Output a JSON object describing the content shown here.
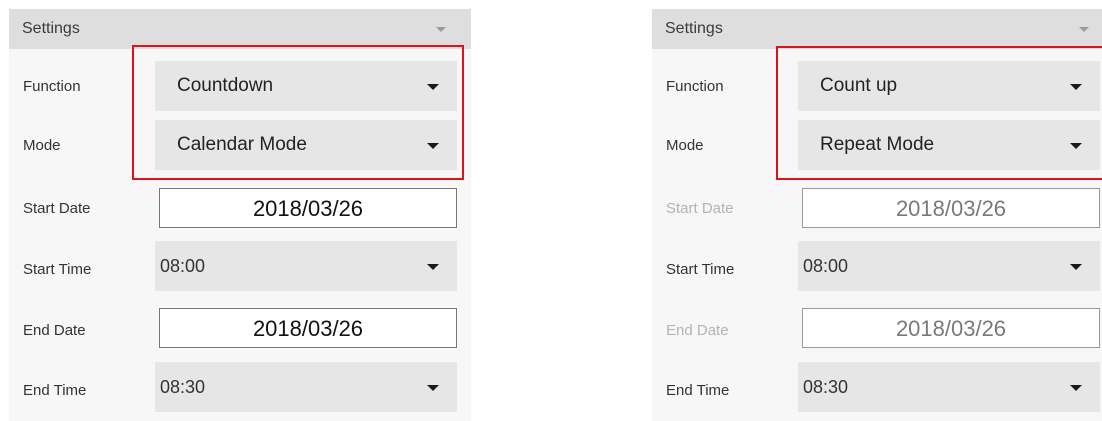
{
  "panels": [
    {
      "header": "Settings",
      "function": {
        "label": "Function",
        "value": "Countdown"
      },
      "mode": {
        "label": "Mode",
        "value": "Calendar Mode"
      },
      "start_date": {
        "label": "Start Date",
        "value": "2018/03/26",
        "enabled": true
      },
      "start_time": {
        "label": "Start Time",
        "value": "08:00"
      },
      "end_date": {
        "label": "End Date",
        "value": "2018/03/26",
        "enabled": true
      },
      "end_time": {
        "label": "End Time",
        "value": "08:30"
      }
    },
    {
      "header": "Settings",
      "function": {
        "label": "Function",
        "value": "Count up"
      },
      "mode": {
        "label": "Mode",
        "value": "Repeat Mode"
      },
      "start_date": {
        "label": "Start Date",
        "value": "2018/03/26",
        "enabled": false
      },
      "start_time": {
        "label": "Start Time",
        "value": "08:00"
      },
      "end_date": {
        "label": "End Date",
        "value": "2018/03/26",
        "enabled": false
      },
      "end_time": {
        "label": "End Time",
        "value": "08:30"
      }
    }
  ],
  "colors": {
    "highlight": "#d9141c",
    "header_bg": "#dedede",
    "dropdown_bg": "#e6e6e6",
    "disabled_text": "#b3b3b3"
  }
}
